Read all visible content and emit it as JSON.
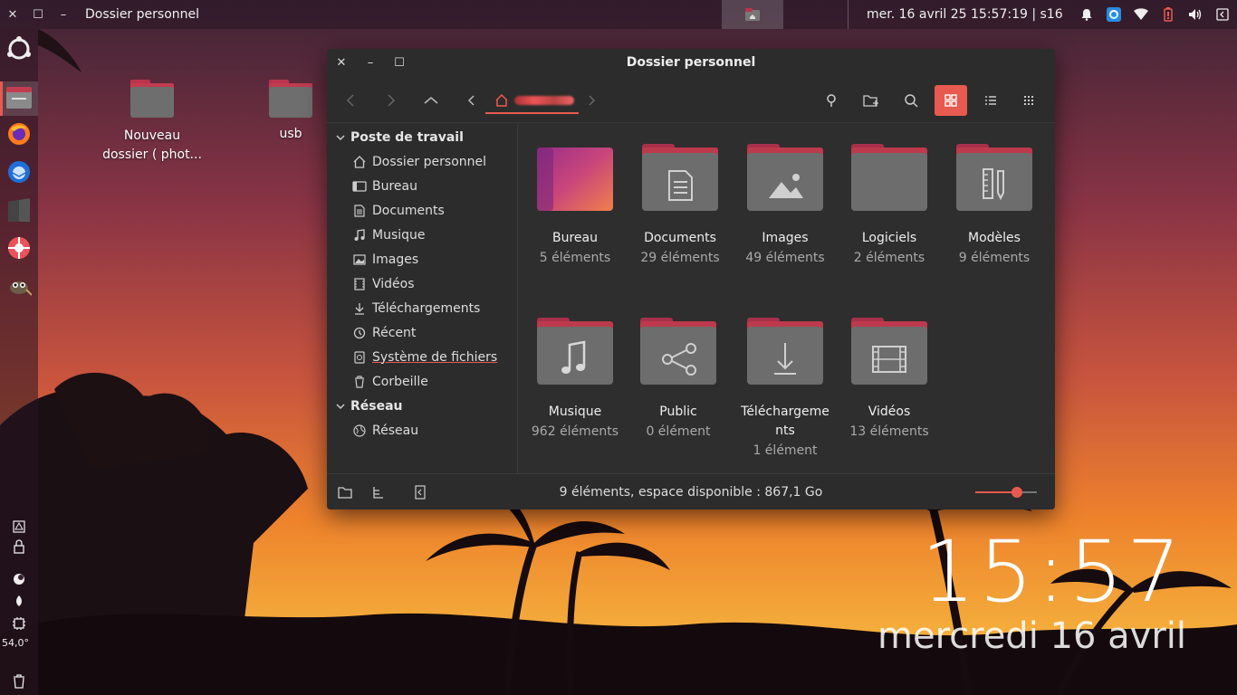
{
  "topbar": {
    "window_title": "Dossier personnel",
    "clock": "mer. 16 avril 25 15:57:19 | s16"
  },
  "desktop": {
    "icons": [
      {
        "label": "Nouveau dossier ( phot..."
      },
      {
        "label": "usb"
      }
    ],
    "big_time": "15:57",
    "big_date": "mercredi 16 avril"
  },
  "dock": {
    "temperature": "54,0°"
  },
  "window": {
    "title": "Dossier personnel",
    "sidebar": {
      "section1": "Poste de travail",
      "items": [
        {
          "label": "Dossier personnel",
          "icon": "home-icon"
        },
        {
          "label": "Bureau",
          "icon": "desktop-icon"
        },
        {
          "label": "Documents",
          "icon": "document-icon"
        },
        {
          "label": "Musique",
          "icon": "music-icon"
        },
        {
          "label": "Images",
          "icon": "image-icon"
        },
        {
          "label": "Vidéos",
          "icon": "video-icon"
        },
        {
          "label": "Téléchargements",
          "icon": "download-icon"
        },
        {
          "label": "Récent",
          "icon": "recent-icon"
        },
        {
          "label": "Système de fichiers",
          "icon": "drive-icon"
        },
        {
          "label": "Corbeille",
          "icon": "trash-icon"
        }
      ],
      "section2": "Réseau",
      "network_item": "Réseau"
    },
    "folders": [
      {
        "name": "Bureau",
        "count": "5 éléments"
      },
      {
        "name": "Documents",
        "count": "29 éléments"
      },
      {
        "name": "Images",
        "count": "49 éléments"
      },
      {
        "name": "Logiciels",
        "count": "2 éléments"
      },
      {
        "name": "Modèles",
        "count": "9 éléments"
      },
      {
        "name": "Musique",
        "count": "962 éléments"
      },
      {
        "name": "Public",
        "count": "0 élément"
      },
      {
        "name": "Téléchargeme nts",
        "count": "1 élément"
      },
      {
        "name": "Vidéos",
        "count": "13 éléments"
      }
    ],
    "status": "9 éléments, espace disponible : 867,1 Go",
    "zoom_level": 0.67
  },
  "colors": {
    "accent": "#e85a4f",
    "folder_top": "#b9344a",
    "folder_body": "#6d6d6d"
  }
}
